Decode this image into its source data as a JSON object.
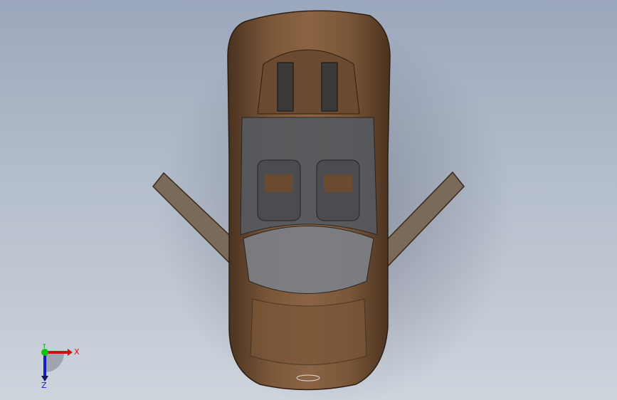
{
  "viewport": {
    "view": "top",
    "background_colors": [
      "#9ba7bc",
      "#ced4dc"
    ],
    "model_color": "#6b4a30"
  },
  "triad": {
    "x_label": "X",
    "y_label": "Y",
    "z_label": "Z",
    "colors": {
      "x": "#e01010",
      "y": "#10c010",
      "z": "#1020c0"
    }
  }
}
